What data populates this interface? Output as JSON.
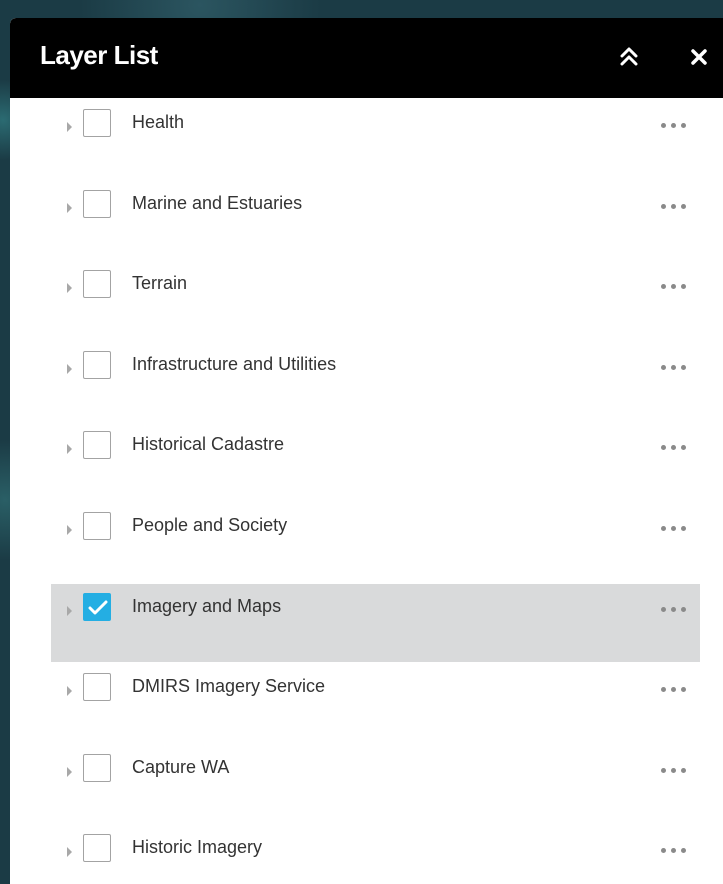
{
  "panel": {
    "title": "Layer List",
    "collapse_icon": "double-chevron-up-icon",
    "close_icon": "close-icon",
    "header_color": "#000000"
  },
  "layers": [
    {
      "label": "Health",
      "checked": false
    },
    {
      "label": "Marine and Estuaries",
      "checked": false
    },
    {
      "label": "Terrain",
      "checked": false
    },
    {
      "label": "Infrastructure and Utilities",
      "checked": false
    },
    {
      "label": "Historical Cadastre",
      "checked": false
    },
    {
      "label": "People and Society",
      "checked": false
    },
    {
      "label": "Imagery and Maps",
      "checked": true,
      "selected": true
    },
    {
      "label": "DMIRS Imagery Service",
      "checked": false
    },
    {
      "label": "Capture WA",
      "checked": false
    },
    {
      "label": "Historic Imagery",
      "checked": false
    }
  ],
  "colors": {
    "checkbox_checked": "#24aee3",
    "selected_row": "#d9dadb"
  }
}
